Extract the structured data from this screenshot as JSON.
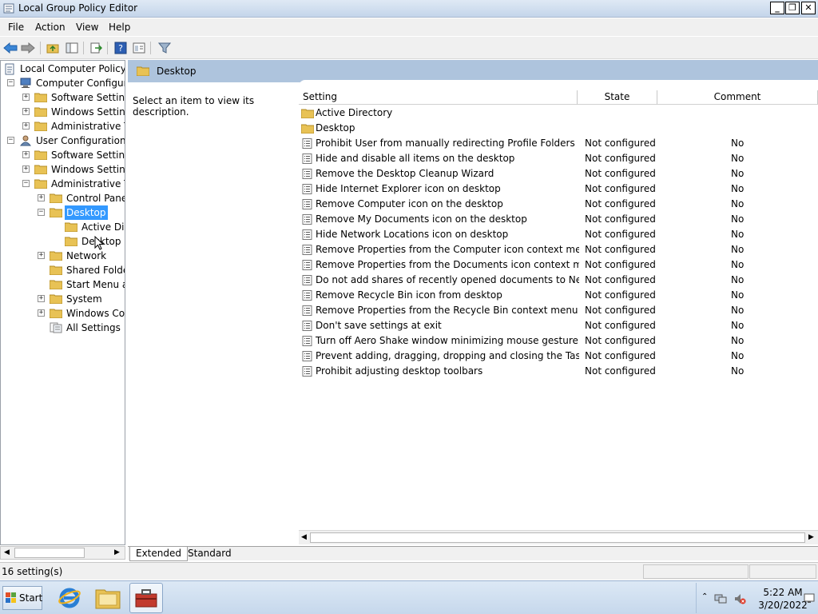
{
  "window": {
    "title": "Local Group Policy Editor"
  },
  "window_buttons": {
    "minimize": "_",
    "restore": "❐",
    "close": "✕"
  },
  "menu": [
    "File",
    "Action",
    "View",
    "Help"
  ],
  "tree": {
    "root": "Local Computer Policy",
    "computer_config": "Computer Configura",
    "cc_software": "Software Settings",
    "cc_windows": "Windows Setting",
    "cc_admin": "Administrative Te",
    "user_config": "User Configuration",
    "uc_software": "Software Settings",
    "uc_windows": "Windows Setting",
    "uc_admin": "Administrative Te",
    "control_panel": "Control Panel",
    "desktop": "Desktop",
    "active_dir": "Active Dir",
    "desktop_sub": "Desktop",
    "network": "Network",
    "shared_folders": "Shared Folder",
    "start_menu": "Start Menu ar",
    "system": "System",
    "windows_components": "Windows Cor",
    "all_settings": "All Settings"
  },
  "content": {
    "header": "Desktop",
    "description": "Select an item to view its description.",
    "columns": {
      "setting": "Setting",
      "state": "State",
      "comment": "Comment"
    },
    "folders": [
      "Active Directory",
      "Desktop"
    ],
    "rows": [
      {
        "name": "Prohibit User from manually redirecting Profile Folders",
        "state": "Not configured",
        "comment": "No"
      },
      {
        "name": "Hide and disable all items on the desktop",
        "state": "Not configured",
        "comment": "No"
      },
      {
        "name": "Remove the Desktop Cleanup Wizard",
        "state": "Not configured",
        "comment": "No"
      },
      {
        "name": "Hide Internet Explorer icon on desktop",
        "state": "Not configured",
        "comment": "No"
      },
      {
        "name": "Remove Computer icon on the desktop",
        "state": "Not configured",
        "comment": "No"
      },
      {
        "name": "Remove My Documents icon on the desktop",
        "state": "Not configured",
        "comment": "No"
      },
      {
        "name": "Hide Network Locations icon on desktop",
        "state": "Not configured",
        "comment": "No"
      },
      {
        "name": "Remove Properties from the Computer icon context menu",
        "state": "Not configured",
        "comment": "No"
      },
      {
        "name": "Remove Properties from the Documents icon context menu",
        "state": "Not configured",
        "comment": "No"
      },
      {
        "name": "Do not add shares of recently opened documents to Networ...",
        "state": "Not configured",
        "comment": "No"
      },
      {
        "name": "Remove Recycle Bin icon from desktop",
        "state": "Not configured",
        "comment": "No"
      },
      {
        "name": "Remove Properties from the Recycle Bin context menu",
        "state": "Not configured",
        "comment": "No"
      },
      {
        "name": "Don't save settings at exit",
        "state": "Not configured",
        "comment": "No"
      },
      {
        "name": "Turn off Aero Shake window minimizing mouse gesture",
        "state": "Not configured",
        "comment": "No"
      },
      {
        "name": "Prevent adding, dragging, dropping and closing the Taskbar...",
        "state": "Not configured",
        "comment": "No"
      },
      {
        "name": "Prohibit adjusting desktop toolbars",
        "state": "Not configured",
        "comment": "No"
      }
    ]
  },
  "tabs": [
    "Extended",
    "Standard"
  ],
  "status": {
    "text": "16 setting(s)"
  },
  "taskbar": {
    "start_label": "Start",
    "time": "5:22 AM",
    "date": "3/20/2022"
  },
  "colors": {
    "selection": "#3399ff",
    "header_band": "#aec4dd",
    "folder": "#e8c255"
  }
}
